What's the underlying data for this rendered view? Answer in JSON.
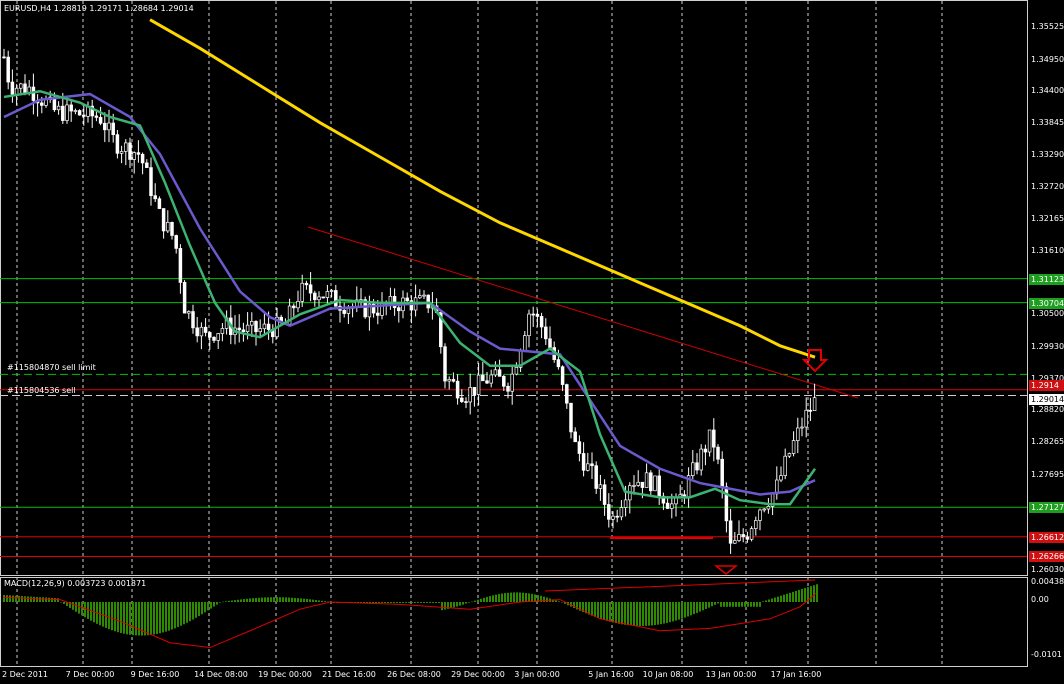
{
  "header": {
    "symbol_info": "EURUSD,H4  1.28819 1.29171 1.28684 1.29014"
  },
  "indicator": {
    "label": "MACD(12,26,9) 0.003723 0.001871"
  },
  "orders": [
    {
      "label": "#115804870 sell limit",
      "price": 1.2945
    },
    {
      "label": "#115804536 sell",
      "price": 1.2918
    }
  ],
  "price_axis": {
    "ticks": [
      "1.35525",
      "1.34950",
      "1.34400",
      "1.33845",
      "1.33290",
      "1.32720",
      "1.32165",
      "1.31610",
      "1.31123",
      "1.30704",
      "1.30500",
      "1.29930",
      "1.29370",
      "1.29014",
      "1.28820",
      "1.28265",
      "1.27695",
      "1.27127",
      "1.26612",
      "1.26266",
      "1.26030"
    ],
    "tick_values": [
      1.35525,
      1.3495,
      1.344,
      1.33845,
      1.3329,
      1.3272,
      1.32165,
      1.3161,
      1.31123,
      1.30704,
      1.305,
      1.2993,
      1.2937,
      1.29014,
      1.2882,
      1.28265,
      1.27695,
      1.27127,
      1.26612,
      1.26266,
      1.2603
    ],
    "tagged": {
      "1.31123": "green",
      "1.30704": "green",
      "1.27127": "green",
      "1.26612": "red",
      "1.26266": "red",
      "1.29014": "white"
    },
    "extra_tag": "1.2914"
  },
  "macd_axis": {
    "ticks": [
      "0.00438",
      "0.00",
      "-0.0101"
    ]
  },
  "time_axis": {
    "labels": [
      "2 Dec 2011",
      "7 Dec 00:00",
      "9 Dec 16:00",
      "14 Dec 08:00",
      "19 Dec 00:00",
      "21 Dec 16:00",
      "26 Dec 08:00",
      "29 Dec 00:00",
      "3 Jan 00:00",
      "5 Jan 16:00",
      "10 Jan 08:00",
      "13 Jan 00:00",
      "17 Jan 16:00"
    ]
  },
  "colors": {
    "background": "#000000",
    "bull_candle": "#ffffff",
    "bear_candle": "#ffffff",
    "ma_fast": "#3cb371",
    "ma_slow": "#6a5acd",
    "ma_long": "#ffd700",
    "support_line": "#00c000",
    "resistance_line": "#e00000",
    "trendline": "#cc0000",
    "histogram": "#2e8b00",
    "signal": "#e00000"
  },
  "icons": [
    "sell-arrow-down-icon",
    "buy-arrow-up-icon"
  ]
}
